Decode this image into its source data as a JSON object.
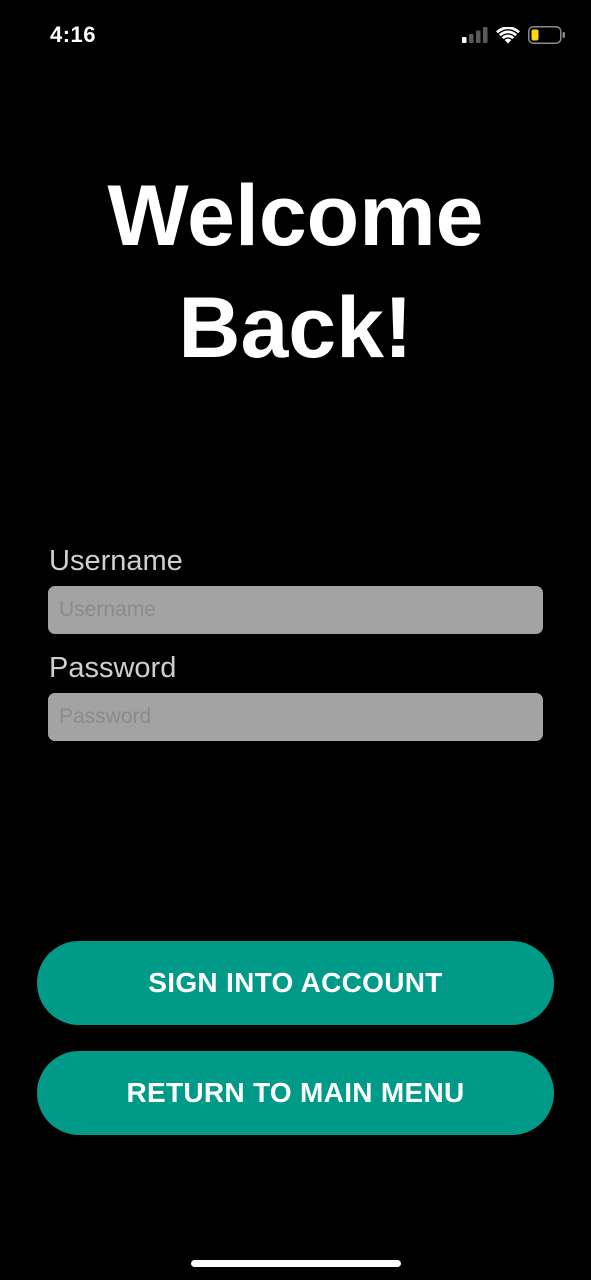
{
  "status_bar": {
    "time": "4:16",
    "icons": [
      "cellular-signal-icon",
      "wifi-icon",
      "battery-low-icon"
    ],
    "battery_color": "#ffd60a"
  },
  "title": {
    "line1": "Welcome",
    "line2": "Back!"
  },
  "form": {
    "username_label": "Username",
    "username_placeholder": "Username",
    "username_value": "",
    "password_label": "Password",
    "password_placeholder": "Password",
    "password_value": ""
  },
  "buttons": {
    "sign_in_label": "SIGN INTO ACCOUNT",
    "return_label": "RETURN TO MAIN MENU"
  },
  "colors": {
    "background": "#000000",
    "accent": "#009a89",
    "field_background": "#a3a3a3",
    "label_text": "#cfcfcf"
  }
}
